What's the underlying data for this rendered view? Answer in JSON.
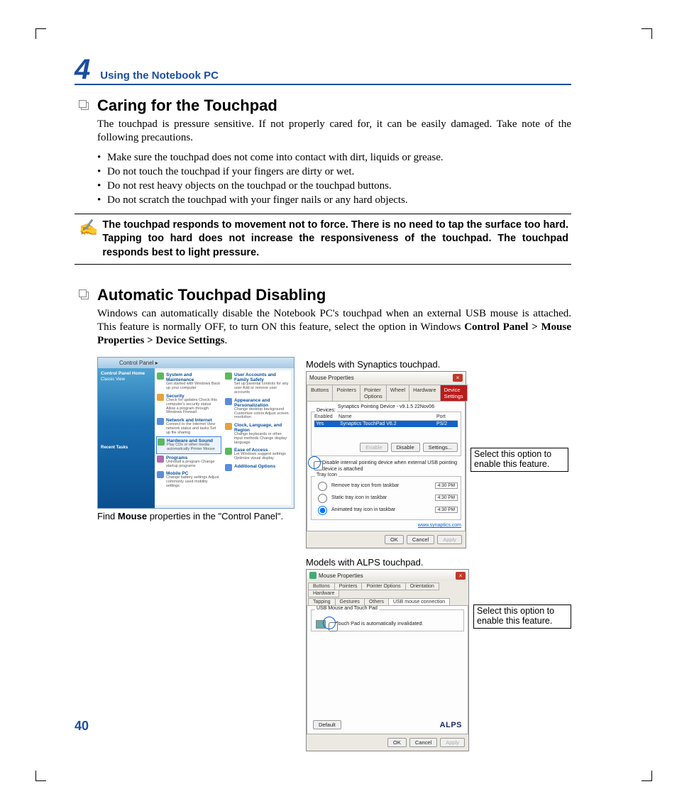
{
  "chapter": {
    "num": "4",
    "title": "Using the Notebook PC"
  },
  "section1": {
    "title": "Caring for the Touchpad",
    "intro": "The touchpad is pressure sensitive. If not properly cared for, it can be easily damaged. Take note of the following precautions.",
    "bullets": [
      "Make sure the touchpad does not come into contact with dirt, liquids or grease.",
      "Do not touch the touchpad if your fingers are dirty or wet.",
      "Do not rest heavy objects on the touchpad or the touchpad buttons.",
      "Do not scratch the touchpad with your finger nails or any hard objects."
    ],
    "note": "The touchpad responds to movement not to force. There is no need to tap the surface too hard. Tapping too hard does not increase the responsiveness of the touchpad. The touchpad responds best to light pressure."
  },
  "section2": {
    "title": "Automatic Touchpad Disabling",
    "p1a": "Windows can automatically disable the Notebook PC's touchpad when an external USB mouse is attached. This feature is normally OFF, to turn ON this feature, select the option in Windows ",
    "p1b": "Control Panel > Mouse Properties > Device Settings",
    "p1c": "."
  },
  "controlPanel": {
    "breadcrumb": "Control Panel  ▸",
    "sidebarTitle": "Control Panel Home",
    "sidebarSub": "Classic View",
    "recentTitle": "Recent Tasks",
    "col1": [
      {
        "t": "System and Maintenance",
        "s": "Get started with Windows\nBack up your computer"
      },
      {
        "t": "Security",
        "s": "Check for updates\nCheck this computer's security status\nAllow a program through Windows Firewall"
      },
      {
        "t": "Network and Internet",
        "s": "Connect to the Internet\nView network status and tasks\nSet up file sharing"
      },
      {
        "t": "Hardware and Sound",
        "s": "Play CDs or other media automatically\nPrinter\nMouse"
      },
      {
        "t": "Programs",
        "s": "Uninstall a program\nChange startup programs"
      },
      {
        "t": "Mobile PC",
        "s": "Change battery settings\nAdjust commonly used mobility settings"
      }
    ],
    "col2": [
      {
        "t": "User Accounts and Family Safety",
        "s": "Set up parental controls for any user\nAdd or remove user accounts"
      },
      {
        "t": "Appearance and Personalization",
        "s": "Change desktop background\nCustomize colors\nAdjust screen resolution"
      },
      {
        "t": "Clock, Language, and Region",
        "s": "Change keyboards or other input methods\nChange display language"
      },
      {
        "t": "Ease of Access",
        "s": "Let Windows suggest settings\nOptimize visual display"
      },
      {
        "t": "Additional Options",
        "s": ""
      }
    ],
    "caption_a": "Find ",
    "caption_b": "Mouse",
    "caption_c": " properties in the \"Control Panel\"."
  },
  "syn": {
    "header": "Models with Synaptics touchpad.",
    "winTitle": "Mouse Properties",
    "tabs": [
      "Buttons",
      "Pointers",
      "Pointer Options",
      "Wheel",
      "Hardware",
      "Device Settings"
    ],
    "sub": "Synaptics Pointing Device - v9.1.5 22Nov06",
    "devicesLabel": "Devices:",
    "cols": {
      "c1": "Enabled",
      "c2": "Name",
      "c3": "Port"
    },
    "row": {
      "c1": "Yes",
      "c2": "Synaptics TouchPad V6.2",
      "c3": "PS/2"
    },
    "btnEnable": "Enable",
    "btnDisable": "Disable",
    "btnSettings": "Settings...",
    "check": "Disable internal pointing device when external USB pointing device is attached",
    "trayLabel": "Tray Icon",
    "r1": "Remove tray icon from taskbar",
    "r2": "Static tray icon in taskbar",
    "r3": "Animated tray icon in taskbar",
    "time": "4:30 PM",
    "link": "www.synaptics.com",
    "ok": "OK",
    "cancel": "Cancel",
    "apply": "Apply"
  },
  "alps": {
    "header": "Models with ALPS touchpad.",
    "winTitle": "Mouse Properties",
    "tabs1": [
      "Buttons",
      "Pointers",
      "Pointer Options",
      "Orientation",
      "Hardware"
    ],
    "tabs2": [
      "Tapping",
      "Gestures",
      "Others",
      "USB mouse connection"
    ],
    "groupTitle": "USB Mouse and Touch Pad",
    "check": "Touch Pad is automatically invalidated.",
    "logo": "ALPS",
    "default": "Default",
    "ok": "OK",
    "cancel": "Cancel",
    "apply": "Apply"
  },
  "callout": "Select this option to enable this feature.",
  "pageNumber": "40"
}
